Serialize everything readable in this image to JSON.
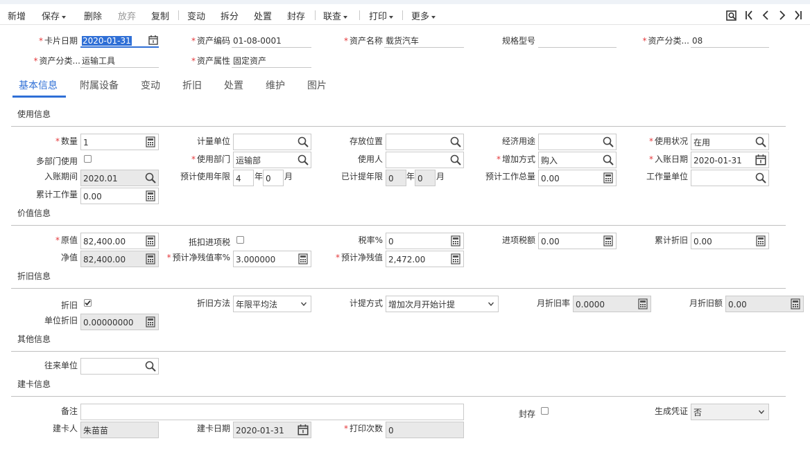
{
  "toolbar": {
    "new": "新增",
    "save": "保存",
    "delete": "删除",
    "abandon": "放弃",
    "copy": "复制",
    "change": "变动",
    "split": "拆分",
    "dispose": "处置",
    "seal": "封存",
    "link": "联查",
    "print": "打印",
    "more": "更多"
  },
  "header": {
    "card_date_label": "卡片日期",
    "card_date": "2020-01-31",
    "asset_code_label": "资产编码",
    "asset_code": "01-08-0001",
    "asset_name_label": "资产名称",
    "asset_name": "载货汽车",
    "spec_label": "规格型号",
    "spec": "",
    "category_label": "资产分类...",
    "category": "08",
    "category2_label": "资产分类...",
    "category2": "运输工具",
    "attribute_label": "资产属性",
    "attribute": "固定资产"
  },
  "tabs": [
    "基本信息",
    "附属设备",
    "变动",
    "折旧",
    "处置",
    "维护",
    "图片"
  ],
  "sections": {
    "usage": "使用信息",
    "value": "价值信息",
    "depreciation": "折旧信息",
    "other": "其他信息",
    "card": "建卡信息"
  },
  "usage": {
    "qty_label": "数量",
    "qty": "1",
    "unit_label": "计量单位",
    "unit": "",
    "location_label": "存放位置",
    "location": "",
    "economic_label": "经济用途",
    "economic": "",
    "status_label": "使用状况",
    "status": "在用",
    "multi_dept_label": "多部门使用",
    "dept_label": "使用部门",
    "dept": "运输部",
    "user_label": "使用人",
    "user": "",
    "add_method_label": "增加方式",
    "add_method": "购入",
    "entry_date_label": "入账日期",
    "entry_date": "2020-01-31",
    "entry_period_label": "入账期间",
    "entry_period": "2020.01",
    "life_label": "预计使用年限",
    "life_years": "4",
    "life_months": "0",
    "year_unit": "年",
    "month_unit": "月",
    "accrued_life_label": "已计提年限",
    "accrued_years": "0",
    "accrued_months": "0",
    "total_work_label": "预计工作总量",
    "total_work": "0.00",
    "work_unit_label": "工作量单位",
    "work_unit": "",
    "accum_work_label": "累计工作量",
    "accum_work": "0.00"
  },
  "value": {
    "original_label": "原值",
    "original": "82,400.00",
    "deduct_tax_label": "抵扣进项税",
    "tax_rate_label": "税率%",
    "tax_rate": "0",
    "input_tax_label": "进项税额",
    "input_tax": "0.00",
    "accum_dep_label": "累计折旧",
    "accum_dep": "0.00",
    "net_label": "净值",
    "net": "82,400.00",
    "residual_rate_label": "预计净残值率%",
    "residual_rate": "3.000000",
    "residual_label": "预计净残值",
    "residual": "2,472.00"
  },
  "depreciation": {
    "dep_label": "折旧",
    "method_label": "折旧方法",
    "method": "年限平均法",
    "calc_label": "计提方式",
    "calc": "增加次月开始计提",
    "monthly_rate_label": "月折旧率",
    "monthly_rate": "0.0000",
    "monthly_amount_label": "月折旧额",
    "monthly_amount": "0.00",
    "unit_dep_label": "单位折旧",
    "unit_dep": "0.00000000"
  },
  "other": {
    "partner_label": "往来单位",
    "partner": ""
  },
  "card": {
    "remark_label": "备注",
    "remark": "",
    "seal_label": "封存",
    "voucher_label": "生成凭证",
    "voucher": "否",
    "creator_label": "建卡人",
    "creator": "朱苗苗",
    "create_date_label": "建卡日期",
    "create_date": "2020-01-31",
    "print_count_label": "打印次数",
    "print_count": "0"
  }
}
